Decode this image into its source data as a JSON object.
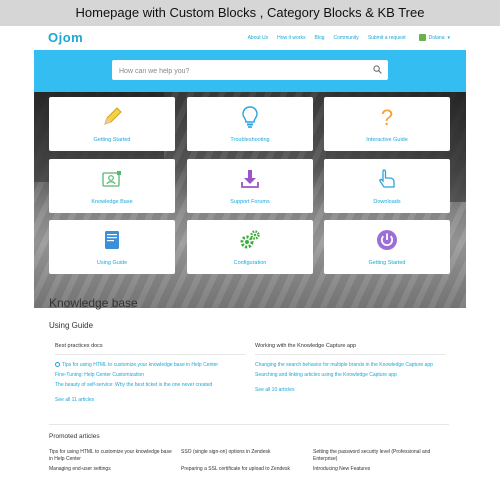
{
  "caption": "Homepage with Custom Blocks , Category Blocks & KB Tree",
  "header": {
    "logo": "Ojom",
    "nav": [
      "About Us",
      "How it works",
      "Blog",
      "Community",
      "Submit a request"
    ],
    "user": "Dolana"
  },
  "search": {
    "placeholder": "How can we help you?"
  },
  "categories": [
    {
      "label": "Getting Started",
      "icon": "pencil-icon"
    },
    {
      "label": "Troubleshooting",
      "icon": "lightbulb-icon"
    },
    {
      "label": "Interactive Guide",
      "icon": "question-mark-icon"
    },
    {
      "label": "Knowledge Base",
      "icon": "id-card-icon"
    },
    {
      "label": "Support Forums",
      "icon": "download-icon"
    },
    {
      "label": "Downloads",
      "icon": "pointer-hand-icon"
    },
    {
      "label": "Using Guide",
      "icon": "book-icon"
    },
    {
      "label": "Configuration",
      "icon": "gears-icon"
    },
    {
      "label": "Getting Started",
      "icon": "power-icon"
    }
  ],
  "knowledge_base": {
    "title": "Knowledge base",
    "section": "Using Guide",
    "columns": [
      {
        "heading": "Best practices docs",
        "links": [
          "Tips for using HTML to customize your knowledge base in Help Center",
          "Fine-Tuning: Help Center Customization",
          "The beauty of self-service: Why the best ticket is the one never created"
        ],
        "see_all": "See all 11 articles"
      },
      {
        "heading": "Working with the Knowledge Capture app",
        "links": [
          "Changing the search behavior for multiple brands in the Knowledge Capture app",
          "Searching and linking articles using the Knowledge Capture app"
        ],
        "see_all": "See all 10 articles"
      }
    ]
  },
  "promoted": {
    "title": "Promoted articles",
    "columns": [
      [
        "Tips for using HTML to customize your knowledge base in Help Center",
        "Managing end-user settings"
      ],
      [
        "SSO (single sign-on) options in Zendesk",
        "Preparing a SSL certificate for upload to Zendesk"
      ],
      [
        "Setting the password security level (Professional and Enterprise)",
        "Introducing New Features"
      ]
    ]
  },
  "colors": {
    "accent": "#1aa8d8",
    "hero": "#33bdf0"
  }
}
